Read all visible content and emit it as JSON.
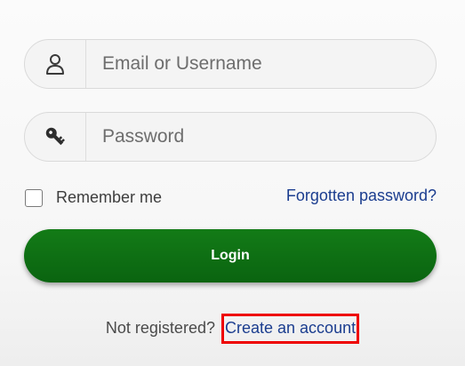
{
  "login_form": {
    "username": {
      "placeholder": "Email or Username",
      "value": "",
      "icon": "user-icon"
    },
    "password": {
      "placeholder": "Password",
      "value": "",
      "icon": "key-icon"
    },
    "remember_me": {
      "label": "Remember me",
      "checked": false
    },
    "forgot_password_label": "Forgotten password?",
    "login_label": "Login",
    "register_prompt": "Not registered?",
    "create_account_label": "Create an account"
  },
  "colors": {
    "primary_button": "#0f6f13",
    "link": "#1b3d8f",
    "highlight_box": "#ee0000"
  }
}
